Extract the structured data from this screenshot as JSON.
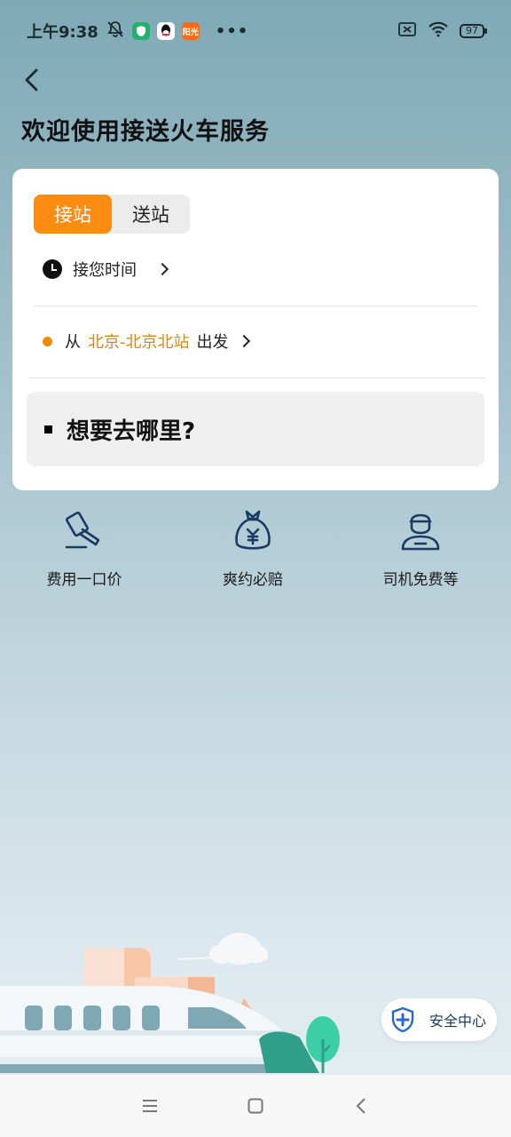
{
  "status_bar": {
    "time": "上午9:38",
    "notif_app3_label": "阳光",
    "more": "•••",
    "battery": "97"
  },
  "header": {
    "title": "欢迎使用接送火车服务"
  },
  "card": {
    "tabs": [
      {
        "label": "接站",
        "active": true
      },
      {
        "label": "送站",
        "active": false
      }
    ],
    "pickup_time_label": "接您时间",
    "from_prefix": "从",
    "from_station": "北京-北京北站",
    "from_suffix": "出发",
    "destination_placeholder": "想要去哪里?"
  },
  "features": [
    {
      "icon": "hammer-icon",
      "label": "费用一口价"
    },
    {
      "icon": "money-bag-icon",
      "label": "爽约必赔"
    },
    {
      "icon": "driver-icon",
      "label": "司机免费等"
    }
  ],
  "safety_center": {
    "label": "安全中心"
  },
  "colors": {
    "accent": "#ff8c12",
    "station_text": "#e0860d",
    "icon_navy": "#1a3a62"
  }
}
